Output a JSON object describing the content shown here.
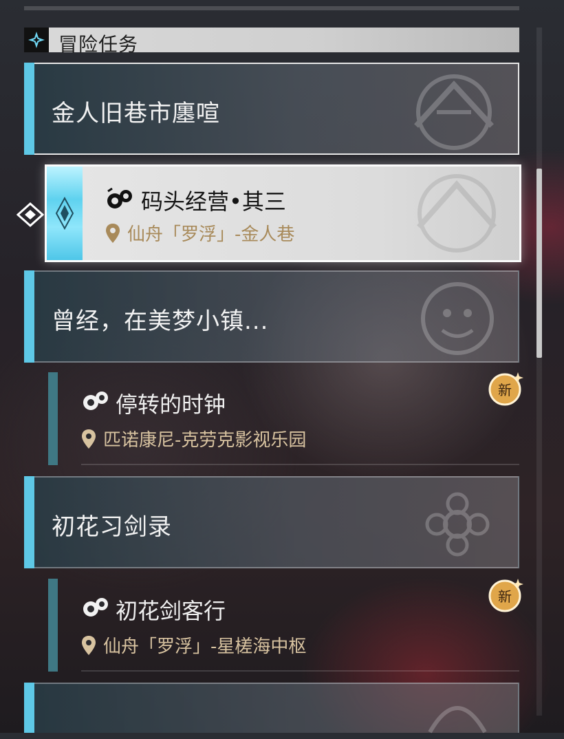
{
  "section": {
    "title": "冒险任务",
    "icon": "sparkle-icon"
  },
  "groups": [
    {
      "title": "金人旧巷市廛喧",
      "active": true
    },
    {
      "title": "曾经，在美梦小镇..."
    },
    {
      "title": "初花习剑录"
    },
    {
      "title": ""
    }
  ],
  "quests": [
    {
      "title": "码头经营•其三",
      "location": "仙舟「罗浮」-金人巷",
      "selected": true
    },
    {
      "title": "停转的时钟",
      "location": "匹诺康尼-克劳克影视乐园",
      "badge": "新"
    },
    {
      "title": "初花剑客行",
      "location": "仙舟「罗浮」-星槎海中枢",
      "badge": "新"
    }
  ],
  "colors": {
    "accent": "#5ec8e6",
    "quest_bar": "#3f7884",
    "location_text": "#d8c3a0",
    "badge": "#e0a64a"
  }
}
